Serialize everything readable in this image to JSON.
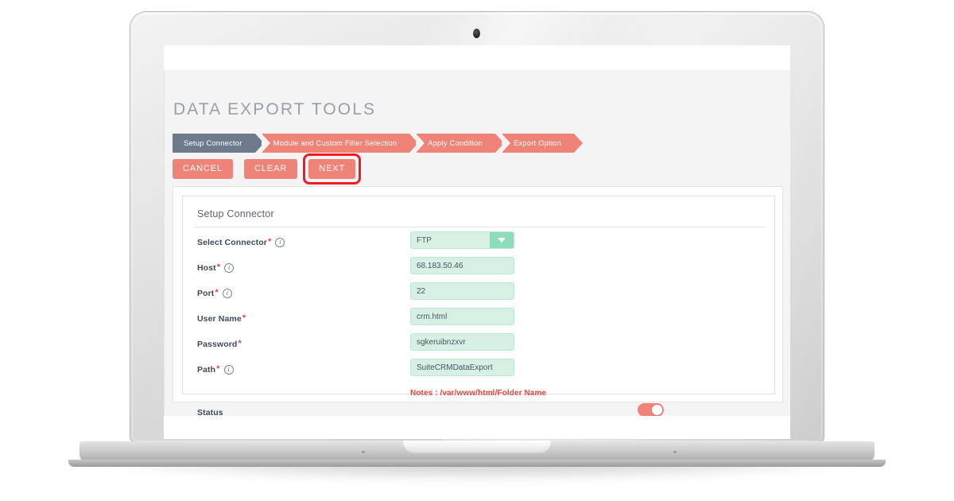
{
  "app": {
    "page_title": "DATA EXPORT TOOLS"
  },
  "steps": [
    {
      "label": "Setup Connector",
      "state": "active"
    },
    {
      "label": "Module and Custom Filter Selection",
      "state": "pending"
    },
    {
      "label": "Apply Condition",
      "state": "pending"
    },
    {
      "label": "Export Option",
      "state": "pending"
    }
  ],
  "buttons": {
    "cancel": "CANCEL",
    "clear": "CLEAR",
    "next": "NEXT"
  },
  "card": {
    "title": "Setup Connector",
    "fields": [
      {
        "label": "Select Connector",
        "required": "*",
        "info": "info-icon",
        "type": "select",
        "value": "FTP"
      },
      {
        "label": "Host",
        "required": "*",
        "info": "info-icon",
        "type": "text",
        "value": "68.183.50.46"
      },
      {
        "label": "Port",
        "required": "*",
        "info": "info-icon",
        "type": "text",
        "value": "22"
      },
      {
        "label": "User Name",
        "required": "*",
        "info": "",
        "type": "text",
        "value": "crm.html"
      },
      {
        "label": "Password",
        "required": "*",
        "info": "",
        "type": "text",
        "value": "sgkeruibnzxvr"
      },
      {
        "label": "Path",
        "required": "*",
        "info": "info-icon",
        "type": "text",
        "value": "SuiteCRMDataExport"
      }
    ],
    "notes": "Notes : /var/www/html/Folder Name",
    "status": {
      "label": "Status",
      "toggle_state": "on"
    }
  },
  "colors": {
    "accent_salmon": "#ef8377",
    "step_active_slate": "#6d7b8d",
    "field_mint": "#d7f0e4",
    "select_arrow_teal": "#8ddcbb",
    "highlight_red": "#ee1c25",
    "notes_red": "#e8433c",
    "title_gray": "#98a0ab"
  }
}
